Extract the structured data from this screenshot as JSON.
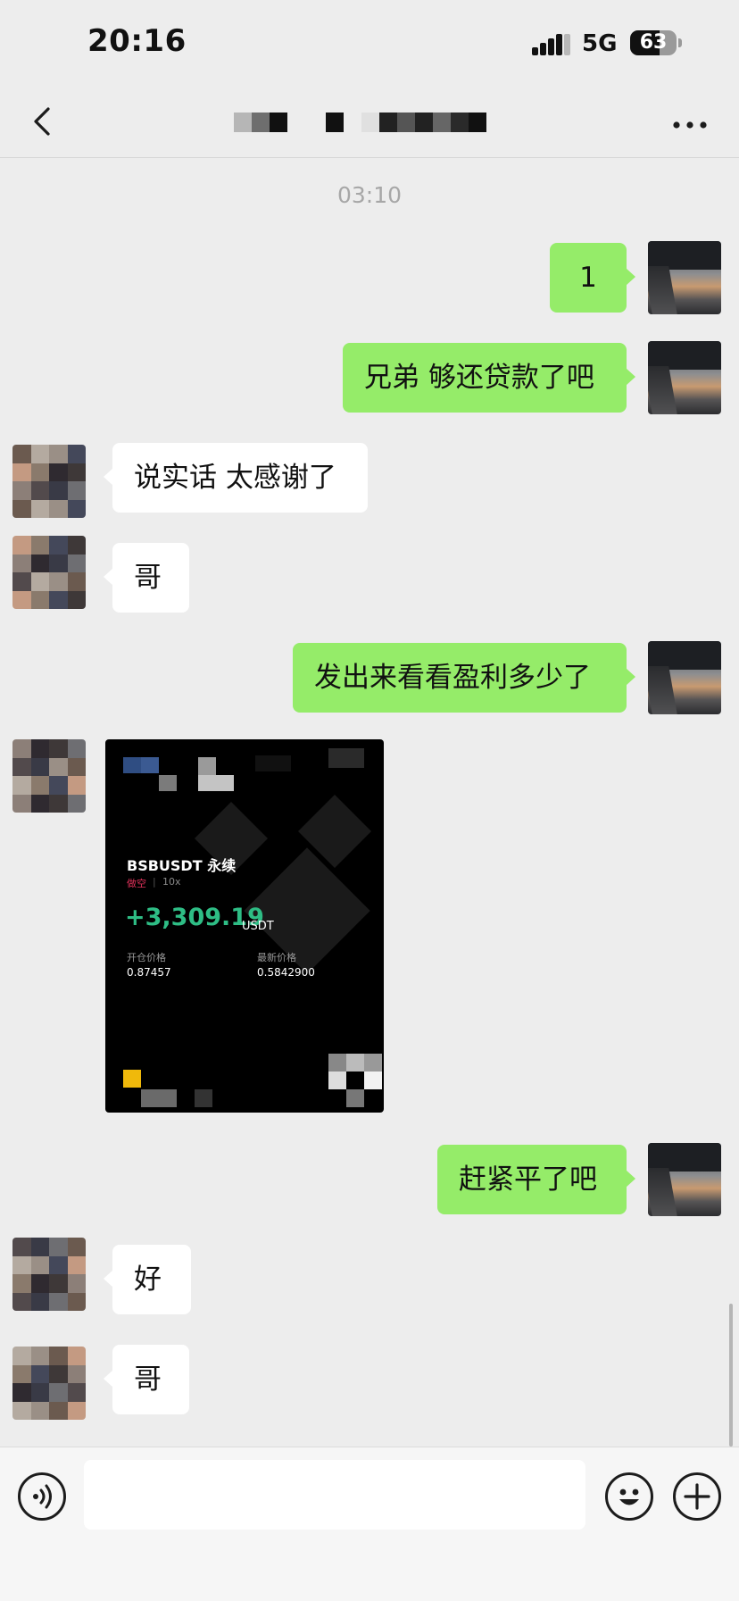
{
  "status_bar": {
    "time": "20:16",
    "network": "5G",
    "battery": "63",
    "battery_level": 0.63
  },
  "nav": {
    "back_icon": "chevron-left-icon",
    "more_icon": "more-dots-icon"
  },
  "chat": {
    "timestamp": "03:10",
    "messages": [
      {
        "from": "me",
        "text": "1"
      },
      {
        "from": "me",
        "text": "兄弟 够还贷款了吧"
      },
      {
        "from": "other",
        "text": "说实话 太感谢了"
      },
      {
        "from": "other",
        "text": "哥"
      },
      {
        "from": "me",
        "text": "发出来看看盈利多少了"
      },
      {
        "from": "other",
        "type": "image"
      },
      {
        "from": "me",
        "text": "赶紧平了吧"
      },
      {
        "from": "other",
        "text": "好"
      },
      {
        "from": "other",
        "text": "哥"
      }
    ],
    "trade_card": {
      "pair": "BSBUSDT 永续",
      "side": "做空",
      "separator": "|",
      "leverage": "10x",
      "pnl": "+3,309.19",
      "pnl_unit": "USDT",
      "entry_label": "开仓价格",
      "entry_value": "0.87457",
      "latest_label": "最新价格",
      "latest_value": "0.5842900",
      "pnl_color": "#2ebd85",
      "side_color": "#e0315a"
    }
  },
  "input_bar": {
    "voice_icon": "voice-icon",
    "emoji_icon": "emoji-icon",
    "plus_icon": "plus-icon",
    "placeholder": ""
  },
  "colors": {
    "sent_bubble": "#95ec69",
    "received_bubble": "#ffffff",
    "background": "#ededed"
  }
}
